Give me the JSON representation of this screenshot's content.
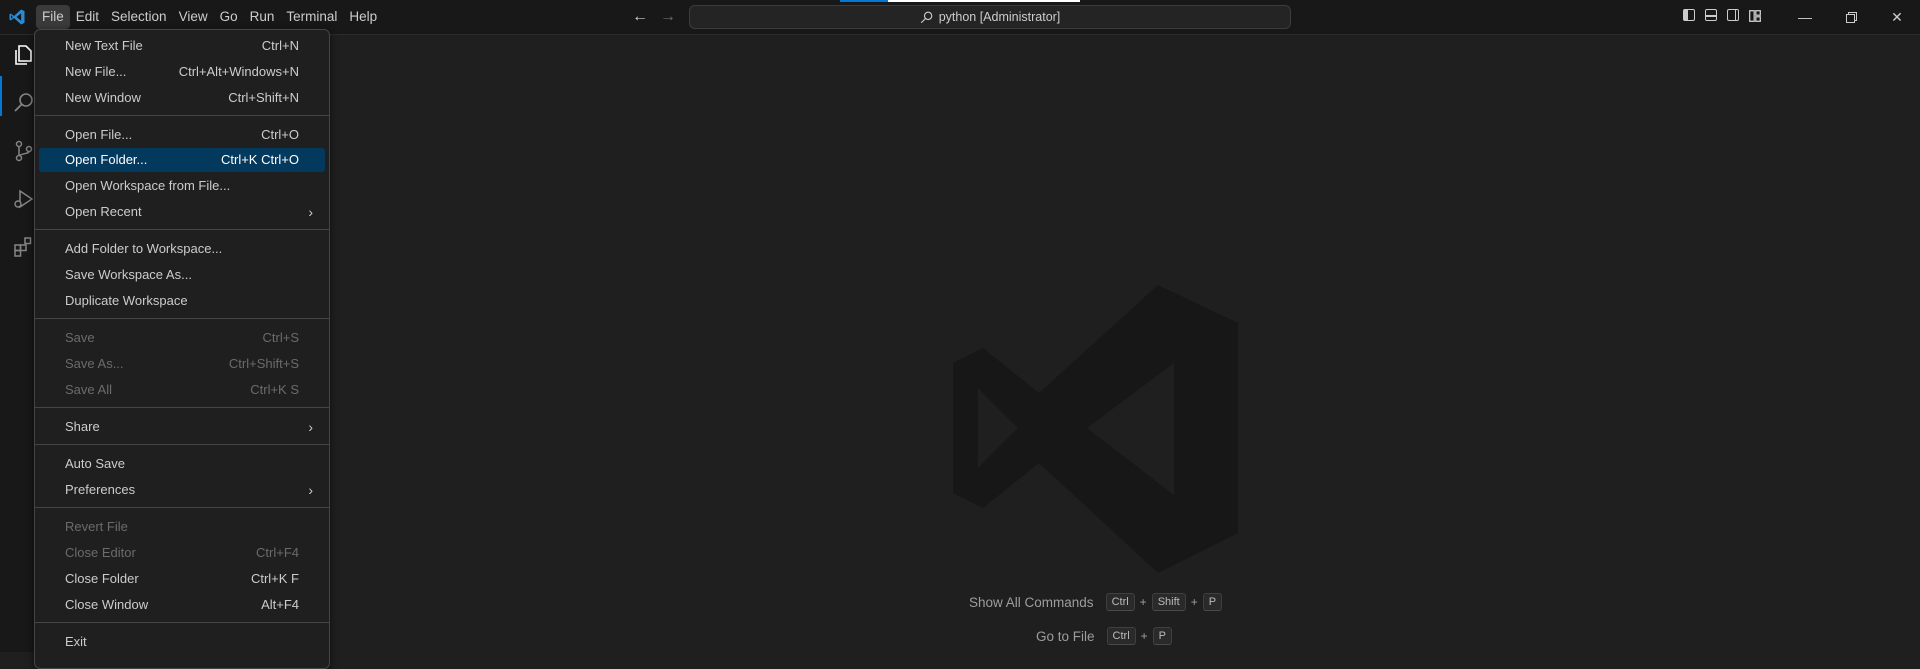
{
  "titlebar": {
    "menu": [
      "File",
      "Edit",
      "Selection",
      "View",
      "Go",
      "Run",
      "Terminal",
      "Help"
    ],
    "active_menu": "File",
    "search_text": "python [Administrator]",
    "window_controls": [
      "minimize-icon",
      "restore-icon",
      "close-icon"
    ]
  },
  "activity_bar": {
    "icons": [
      "explorer-icon",
      "search-icon",
      "source-control-icon",
      "run-debug-icon",
      "extensions-icon"
    ],
    "selected": "explorer-icon"
  },
  "file_menu": {
    "items": [
      {
        "label": "New Text File",
        "shortcut": "Ctrl+N",
        "enabled": true
      },
      {
        "label": "New File...",
        "shortcut": "Ctrl+Alt+Windows+N",
        "enabled": true
      },
      {
        "label": "New Window",
        "shortcut": "Ctrl+Shift+N",
        "enabled": true
      },
      {
        "label": "Open File...",
        "shortcut": "Ctrl+O",
        "enabled": true
      },
      {
        "label": "Open Folder...",
        "shortcut": "Ctrl+K Ctrl+O",
        "enabled": true,
        "highlighted": true
      },
      {
        "label": "Open Workspace from File...",
        "shortcut": "",
        "enabled": true
      },
      {
        "label": "Open Recent",
        "shortcut": "",
        "enabled": true,
        "submenu": true
      },
      {
        "label": "Add Folder to Workspace...",
        "shortcut": "",
        "enabled": true
      },
      {
        "label": "Save Workspace As...",
        "shortcut": "",
        "enabled": true
      },
      {
        "label": "Duplicate Workspace",
        "shortcut": "",
        "enabled": true
      },
      {
        "label": "Save",
        "shortcut": "Ctrl+S",
        "enabled": false
      },
      {
        "label": "Save As...",
        "shortcut": "Ctrl+Shift+S",
        "enabled": false
      },
      {
        "label": "Save All",
        "shortcut": "Ctrl+K S",
        "enabled": false
      },
      {
        "label": "Share",
        "shortcut": "",
        "enabled": true,
        "submenu": true
      },
      {
        "label": "Auto Save",
        "shortcut": "",
        "enabled": true
      },
      {
        "label": "Preferences",
        "shortcut": "",
        "enabled": true,
        "submenu": true
      },
      {
        "label": "Revert File",
        "shortcut": "",
        "enabled": false
      },
      {
        "label": "Close Editor",
        "shortcut": "Ctrl+F4",
        "enabled": false
      },
      {
        "label": "Close Folder",
        "shortcut": "Ctrl+K F",
        "enabled": true
      },
      {
        "label": "Close Window",
        "shortcut": "Alt+F4",
        "enabled": true
      },
      {
        "label": "Exit",
        "shortcut": "",
        "enabled": true
      }
    ]
  },
  "editor_hints": {
    "show_all_commands": {
      "label": "Show All Commands",
      "keys": [
        "Ctrl",
        "Shift",
        "P"
      ]
    },
    "go_to_file": {
      "label": "Go to File",
      "keys": [
        "Ctrl",
        "P"
      ]
    }
  },
  "colors": {
    "accent": "#0078d4",
    "menu_highlight": "#04395e",
    "logo_blue": "#2a8bd4"
  }
}
